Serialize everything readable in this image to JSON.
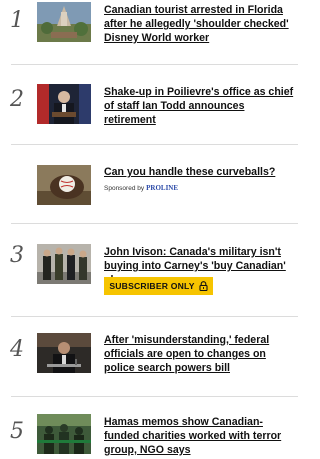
{
  "articles": [
    {
      "rank": "1",
      "headline": "Canadian tourist arrested in Florida after he allegedly 'shoulder checked' Disney World worker"
    },
    {
      "rank": "2",
      "headline": "Shake-up in Poilievre's office as chief of staff Ian Todd announces retirement"
    },
    {
      "rank": "3",
      "headline": "John Ivison: Canada's military isn't buying into Carney's 'buy Canadian' plan",
      "badge": "SUBSCRIBER ONLY"
    },
    {
      "rank": "4",
      "headline": "After 'misunderstanding,' federal officials are open to changes on police search powers bill"
    },
    {
      "rank": "5",
      "headline": "Hamas memos show Canadian-funded charities worked with terror group, NGO says"
    }
  ],
  "sponsored": {
    "headline": "Can you handle these curveballs?",
    "label": "Sponsored by",
    "brand": "PROLINE"
  },
  "colors": {
    "badge": "#f6c400",
    "divider": "#dcdcdc",
    "sponsor_brand": "#2b4aa8"
  }
}
